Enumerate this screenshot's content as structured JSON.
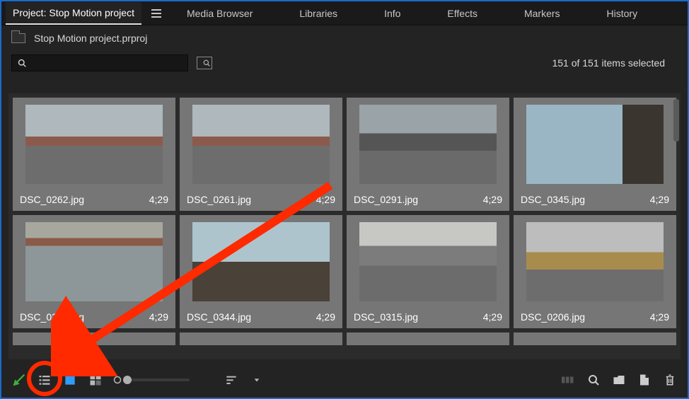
{
  "tabs": {
    "project": "Project: Stop Motion project",
    "media_browser": "Media Browser",
    "libraries": "Libraries",
    "info": "Info",
    "effects": "Effects",
    "markers": "Markers",
    "history": "History"
  },
  "project": {
    "filename": "Stop Motion project.prproj"
  },
  "search": {
    "placeholder": ""
  },
  "status": {
    "selection": "151 of 151 items selected"
  },
  "items": [
    {
      "name": "DSC_0262.jpg",
      "duration": "4;29",
      "thumb": "p-street"
    },
    {
      "name": "DSC_0261.jpg",
      "duration": "4;29",
      "thumb": "p-street"
    },
    {
      "name": "DSC_0291.jpg",
      "duration": "4;29",
      "thumb": "p-parking"
    },
    {
      "name": "DSC_0345.jpg",
      "duration": "4;29",
      "thumb": "p-blue"
    },
    {
      "name": "DSC_0327.jpg",
      "duration": "4;29",
      "thumb": "p-doors"
    },
    {
      "name": "DSC_0344.jpg",
      "duration": "4;29",
      "thumb": "p-stair"
    },
    {
      "name": "DSC_0315.jpg",
      "duration": "4;29",
      "thumb": "p-road"
    },
    {
      "name": "DSC_0206.jpg",
      "duration": "4;29",
      "thumb": "p-crane"
    }
  ],
  "colors": {
    "accent": "#1a6bcc",
    "annotation": "#ff2a00"
  }
}
